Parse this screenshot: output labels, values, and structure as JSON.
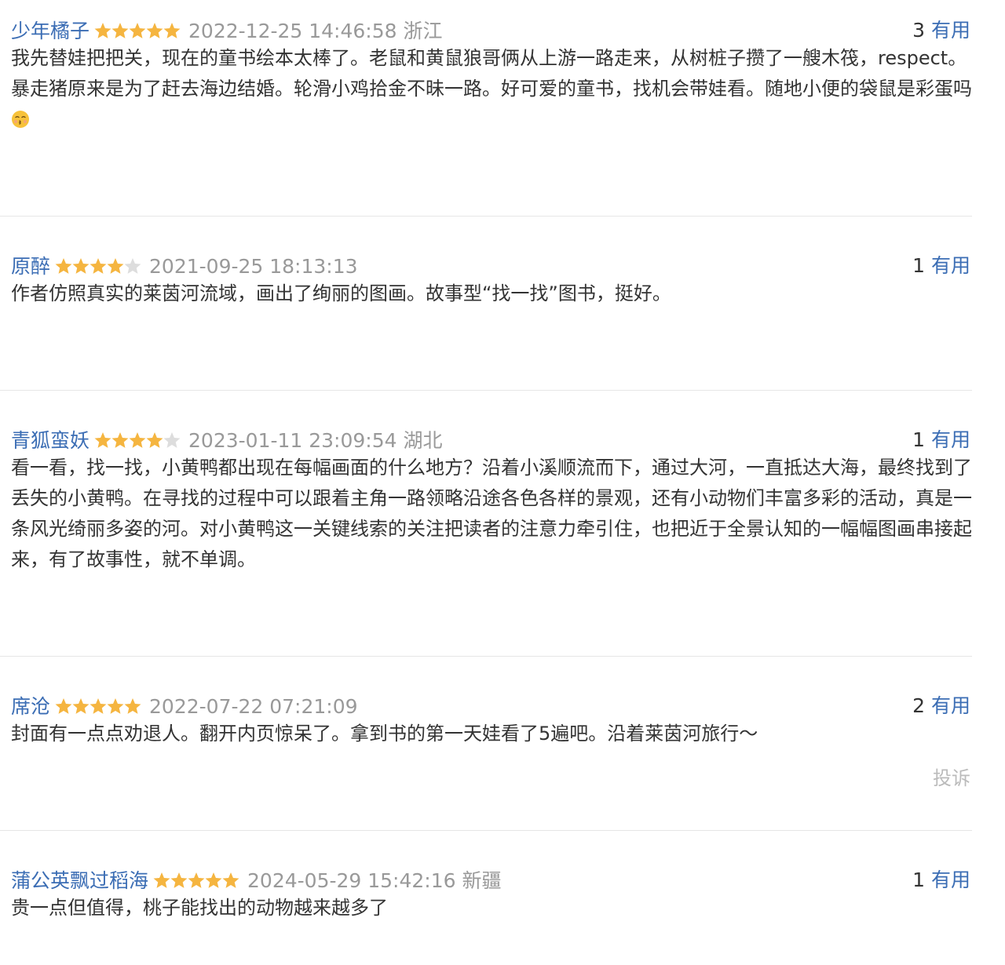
{
  "comments": [
    {
      "user": "少年橘子",
      "rating": 5,
      "time": "2022-12-25 14:46:58",
      "location": "浙江",
      "votes": "3",
      "vote_label": "有用",
      "content": "我先替娃把把关，现在的童书绘本太棒了。老鼠和黄鼠狼哥俩从上游一路走来，从树桩子攒了一艘木筏，respect。暴走猪原来是为了赶去海边结婚。轮滑小鸡拾金不昧一路。好可爱的童书，找机会带娃看。随地小便的袋鼠是彩蛋吗",
      "emoji": "kissing-face-icon"
    },
    {
      "user": "原醉",
      "rating": 4,
      "time": "2021-09-25 18:13:13",
      "location": "",
      "votes": "1",
      "vote_label": "有用",
      "content": "作者仿照真实的莱茵河流域，画出了绚丽的图画。故事型“找一找”图书，挺好。"
    },
    {
      "user": "青狐蛮妖",
      "rating": 4,
      "time": "2023-01-11 23:09:54",
      "location": "湖北",
      "votes": "1",
      "vote_label": "有用",
      "content": "看一看，找一找，小黄鸭都出现在每幅画面的什么地方？沿着小溪顺流而下，通过大河，一直抵达大海，最终找到了丢失的小黄鸭。在寻找的过程中可以跟着主角一路领略沿途各色各样的景观，还有小动物们丰富多彩的活动，真是一条风光绮丽多姿的河。对小黄鸭这一关键线索的关注把读者的注意力牵引住，也把近于全景认知的一幅幅图画串接起来，有了故事性，就不单调。"
    },
    {
      "user": "席沧",
      "rating": 5,
      "time": "2022-07-22 07:21:09",
      "location": "",
      "votes": "2",
      "vote_label": "有用",
      "content": "封面有一点点劝退人。翻开内页惊呆了。拿到书的第一天娃看了5遍吧。沿着莱茵河旅行～",
      "report_label": "投诉"
    },
    {
      "user": "蒲公英飘过稻海",
      "rating": 5,
      "time": "2024-05-29 15:42:16",
      "location": "新疆",
      "votes": "1",
      "vote_label": "有用",
      "content": "贵一点但值得，桃子能找出的动物越来越多了"
    }
  ],
  "colors": {
    "username": "#3b6db4",
    "meta": "#999999",
    "star_on": "#f5b540",
    "star_off": "#dddddd",
    "text": "#333333",
    "separator": "#e6e6e6",
    "report": "#bbbbbb"
  }
}
